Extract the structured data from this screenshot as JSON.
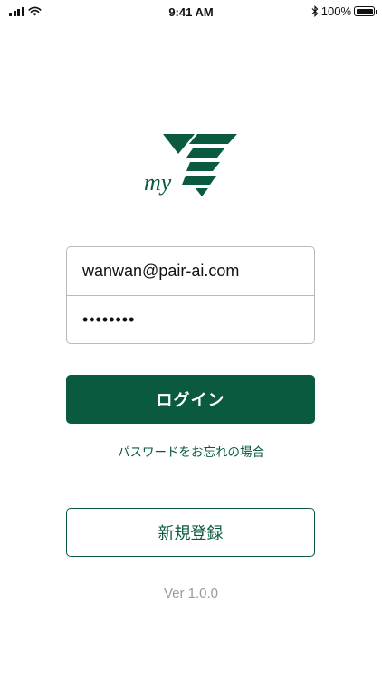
{
  "status_bar": {
    "time": "9:41 AM",
    "battery_label": "100%",
    "icons": [
      "signal-icon",
      "wifi-icon",
      "bluetooth-icon",
      "battery-icon"
    ]
  },
  "logo": {
    "text": "my",
    "brand_color": "#0a5a40"
  },
  "login_form": {
    "email_value": "wanwan@pair-ai.com",
    "password_value": "••••••••"
  },
  "actions": {
    "login_label": "ログイン",
    "forgot_password_label": "パスワードをお忘れの場合",
    "register_label": "新規登録"
  },
  "footer": {
    "version": "Ver 1.0.0"
  },
  "colors": {
    "primary": "#0a5a40",
    "muted": "#9b9b9b",
    "border": "#b9b9b9"
  }
}
